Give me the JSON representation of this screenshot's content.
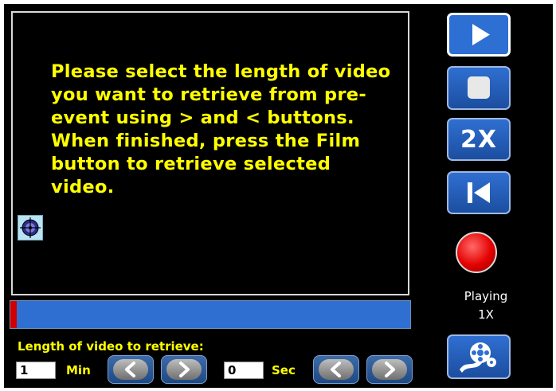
{
  "video": {
    "message": "Please select the length of video you want to retrieve from pre-event using > and < buttons. When finished, press the Film button to retrieve selected video."
  },
  "retrieve": {
    "label": "Length of video to retrieve:",
    "minutes_value": "1",
    "minutes_unit": "Min",
    "seconds_value": "0",
    "seconds_unit": "Sec"
  },
  "controls": {
    "speed_label": "2X",
    "status_line1": "Playing",
    "status_line2": "1X"
  },
  "icons": [
    "play-icon",
    "stop-icon",
    "rewind-to-start-icon",
    "record-icon",
    "film-reel-icon",
    "crosshair-icon",
    "chevron-left-icon",
    "chevron-right-icon"
  ],
  "colors": {
    "accent": "#2f6fd1",
    "message": "#ffff00",
    "record": "#e40000"
  }
}
